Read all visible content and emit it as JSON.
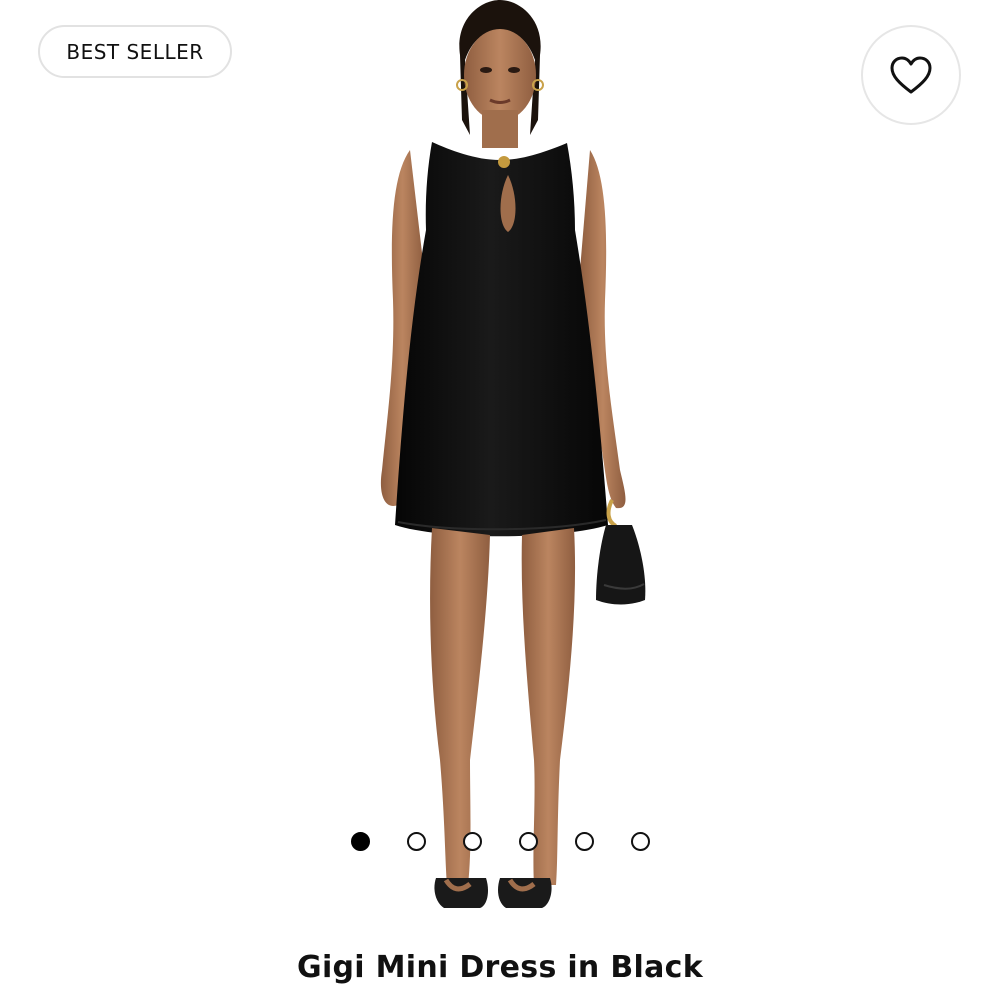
{
  "badge": {
    "label": "BEST SELLER"
  },
  "favorite": {
    "icon": "heart-outline-icon"
  },
  "carousel": {
    "total": 6,
    "active_index": 0
  },
  "product": {
    "title": "Gigi Mini Dress in Black"
  },
  "colors": {
    "text": "#111111",
    "dress": "#0c0c0c",
    "skin": "#b07a55"
  }
}
